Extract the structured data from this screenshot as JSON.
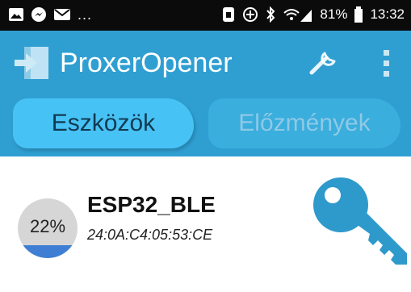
{
  "status_bar": {
    "ellipsis": "...",
    "battery_percent": "81%",
    "time": "13:32"
  },
  "app": {
    "title": "ProxerOpener",
    "accent_color": "#2f9fd2"
  },
  "tabs": [
    {
      "label": "Eszközök",
      "selected": true
    },
    {
      "label": "Előzmények",
      "selected": false
    }
  ],
  "devices": [
    {
      "name": "ESP32_BLE",
      "mac": "24:0A:C4:05:53:CE",
      "progress_label": "22%",
      "progress_fraction": 0.22,
      "action_icon": "key-icon"
    }
  ],
  "icons": {
    "logo": "door-exit-logo",
    "settings": "wrench-icon",
    "overflow": "more-vert-icon"
  }
}
